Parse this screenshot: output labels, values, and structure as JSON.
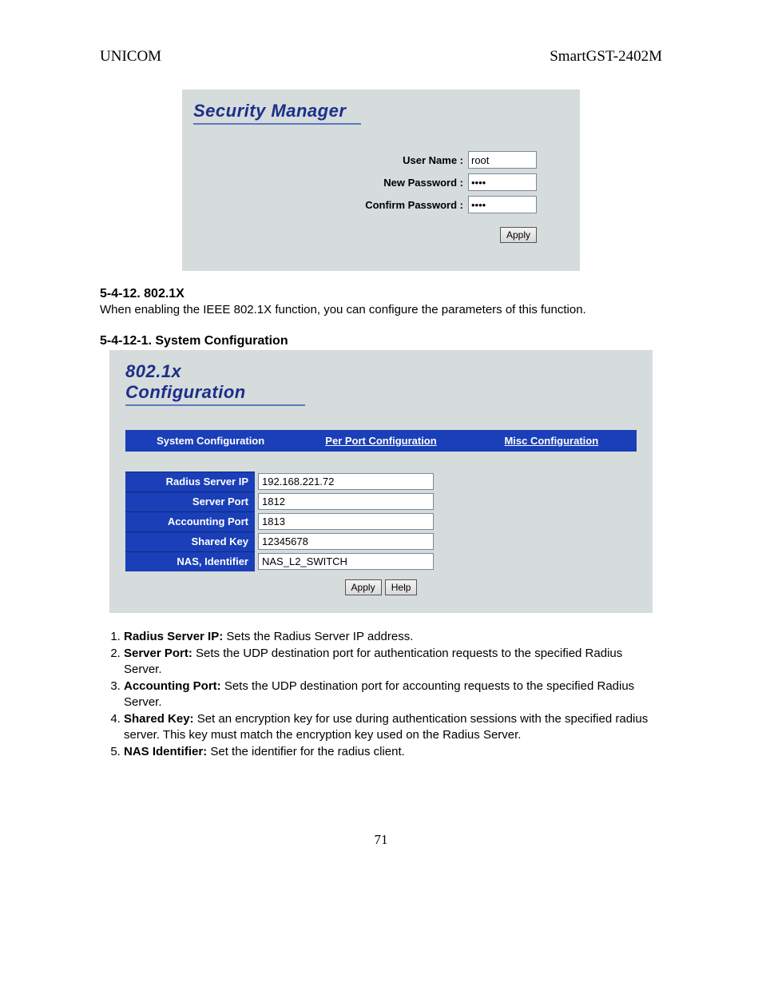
{
  "header": {
    "left": "UNICOM",
    "right": "SmartGST-2402M"
  },
  "security_panel": {
    "title": "Security Manager",
    "rows": [
      {
        "label": "User Name :",
        "value": "root",
        "type": "text"
      },
      {
        "label": "New Password :",
        "value": "••••",
        "type": "text"
      },
      {
        "label": "Confirm Password :",
        "value": "••••",
        "type": "text"
      }
    ],
    "apply": "Apply"
  },
  "section1": {
    "heading": "5-4-12. 802.1X",
    "text": "When enabling the IEEE 802.1X function, you can configure the parameters of this function."
  },
  "section2": {
    "heading": "5-4-12-1. System Configuration"
  },
  "config_panel": {
    "title": "802.1x Configuration",
    "tabs": [
      {
        "label": "System Configuration",
        "active": true
      },
      {
        "label": "Per Port Configuration",
        "active": false
      },
      {
        "label": "Misc Configuration",
        "active": false
      }
    ],
    "fields": [
      {
        "label": "Radius Server IP",
        "value": "192.168.221.72"
      },
      {
        "label": "Server Port",
        "value": "1812"
      },
      {
        "label": "Accounting Port",
        "value": "1813"
      },
      {
        "label": "Shared Key",
        "value": "12345678"
      },
      {
        "label": "NAS, Identifier",
        "value": "NAS_L2_SWITCH"
      }
    ],
    "buttons": {
      "apply": "Apply",
      "help": "Help"
    }
  },
  "list": [
    {
      "term": "Radius Server IP:",
      "desc": " Sets the Radius Server IP address."
    },
    {
      "term": "Server Port:",
      "desc": " Sets the UDP destination port for authentication requests to the specified Radius Server."
    },
    {
      "term": "Accounting Port:",
      "desc": " Sets the UDP destination port for accounting requests to the specified Radius Server."
    },
    {
      "term": "Shared Key:",
      "desc": " Set an encryption key for use during authentication sessions with the specified radius server. This key must match the encryption key used on the Radius Server."
    },
    {
      "term": "NAS Identifier:",
      "desc": " Set the identifier for the radius client."
    }
  ],
  "page_number": "71"
}
